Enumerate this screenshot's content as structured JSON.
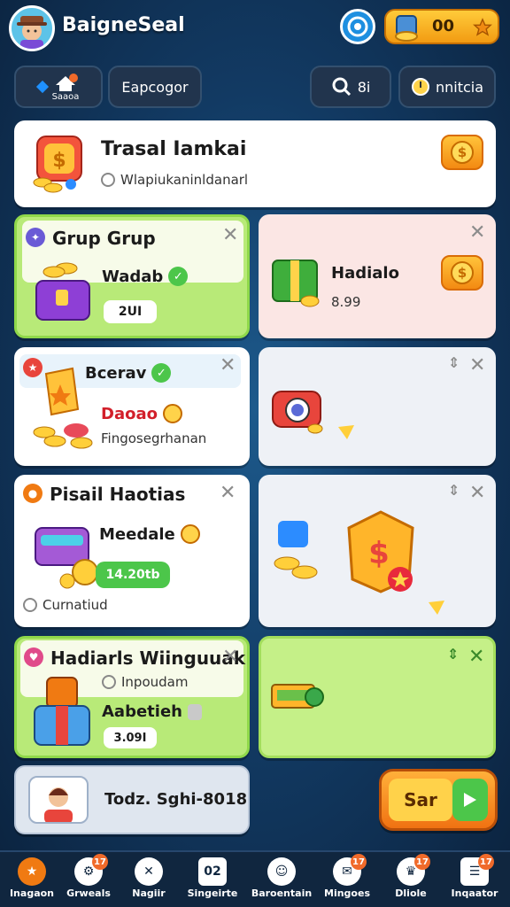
{
  "header": {
    "app_title": "BaigneSeal",
    "coins": "00",
    "target_icon": "target-icon",
    "star_icon": "star-icon"
  },
  "filters": {
    "f1_label": "Saaoa",
    "f2_label": "Eapcogor",
    "f3_label": "8i",
    "f4_label": "nnitcia"
  },
  "banner": {
    "title": "Trasal Iamkai",
    "subtitle": "Wlapiukaninldanarl",
    "button_icon": "dollar-coin-icon"
  },
  "cards": {
    "c1": {
      "title": "Grup Grup",
      "item": "Wadab",
      "count": "2UI"
    },
    "c2": {
      "item": "Hadialo",
      "price": "8.99"
    },
    "c3": {
      "title": "Bcerav",
      "item": "Daoao",
      "desc": "Fingosegrhanan"
    },
    "c5": {
      "title": "Pisail Haotias",
      "item": "Meedale",
      "amount": "14.20tb",
      "note": "Curnatiud"
    },
    "c7": {
      "title": "Hadiarls Wiinguuak",
      "sub": "Inpoudam",
      "item": "Aabetieh",
      "count": "3.09I"
    }
  },
  "profile": {
    "label": "Todz. Sghi-8018"
  },
  "cta": {
    "label": "Sar"
  },
  "nav": {
    "items": [
      {
        "label": "Inagaon",
        "badge": ""
      },
      {
        "label": "Grweals",
        "badge": "17"
      },
      {
        "label": "Nagiir",
        "badge": ""
      },
      {
        "label": "Singeirte",
        "badge": ""
      },
      {
        "label": "Baroentain",
        "badge": ""
      },
      {
        "label": "Mingoes",
        "badge": "17"
      },
      {
        "label": "Dliole",
        "badge": "17"
      },
      {
        "label": "Inqaator",
        "badge": "17"
      }
    ],
    "icon_3_text": "02"
  },
  "colors": {
    "accent_orange": "#f29b12",
    "accent_green": "#4cc64a",
    "background": "#123a63"
  }
}
